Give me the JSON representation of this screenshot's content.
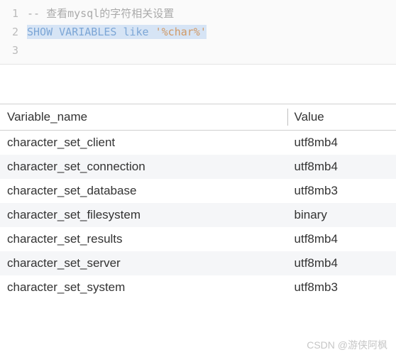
{
  "editor": {
    "lines": [
      {
        "num": "1",
        "comment_prefix": "-- ",
        "comment_text": "查看mysql的字符相关设置"
      },
      {
        "num": "2",
        "kw1": "SHOW",
        "kw2": "VARIABLES",
        "kw3": "like",
        "str": "'%char%'"
      },
      {
        "num": "3"
      }
    ]
  },
  "table": {
    "headers": [
      "Variable_name",
      "Value"
    ],
    "rows": [
      {
        "name": "character_set_client",
        "value": "utf8mb4"
      },
      {
        "name": "character_set_connection",
        "value": "utf8mb4"
      },
      {
        "name": "character_set_database",
        "value": "utf8mb3"
      },
      {
        "name": "character_set_filesystem",
        "value": "binary"
      },
      {
        "name": "character_set_results",
        "value": "utf8mb4"
      },
      {
        "name": "character_set_server",
        "value": "utf8mb4"
      },
      {
        "name": "character_set_system",
        "value": "utf8mb3"
      }
    ]
  },
  "watermark": "CSDN @游侠阿枫"
}
